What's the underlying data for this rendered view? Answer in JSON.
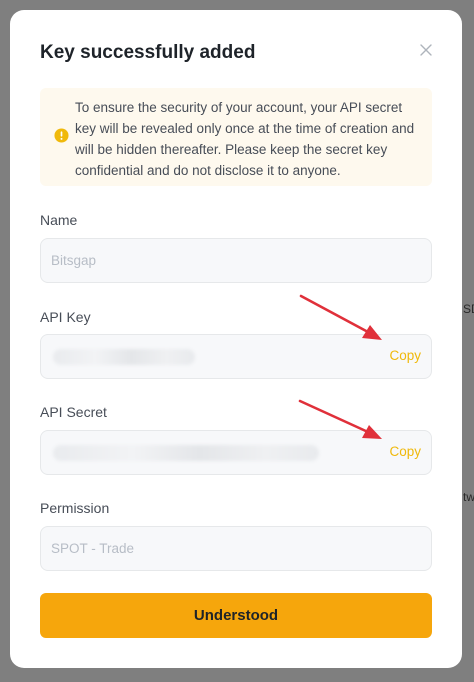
{
  "background": {
    "fragment_right_1": "SD",
    "fragment_right_2": "tw"
  },
  "modal": {
    "title": "Key successfully added",
    "notice": "To ensure the security of your account, your API secret key will be revealed only once at the time of creation and will be hidden thereafter. Please keep the secret key confidential and do not disclose it to anyone.",
    "fields": {
      "name": {
        "label": "Name",
        "placeholder": "Bitsgap"
      },
      "api_key": {
        "label": "API Key",
        "copy_label": "Copy"
      },
      "api_secret": {
        "label": "API Secret",
        "copy_label": "Copy"
      },
      "permission": {
        "label": "Permission",
        "placeholder": "SPOT - Trade"
      }
    },
    "primary_button": "Understood"
  },
  "colors": {
    "accent": "#f0b90b",
    "button": "#f6a60c",
    "notice_bg": "#fef9ee",
    "arrow": "#e0303a"
  },
  "icons": {
    "close": "close-icon",
    "warning": "warning-icon"
  }
}
